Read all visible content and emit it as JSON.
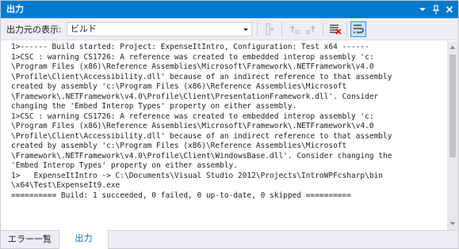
{
  "window": {
    "title": "出力",
    "controls": [
      "chevron-down-icon",
      "pin-icon",
      "close-icon"
    ]
  },
  "toolbar": {
    "source_label": "出力元の表示:",
    "source_value": "ビルド",
    "buttons": [
      {
        "name": "go-to-line-icon",
        "enabled": false
      },
      {
        "name": "find-previous-icon",
        "enabled": false
      },
      {
        "name": "find-next-icon",
        "enabled": false
      },
      {
        "name": "clear-all-icon",
        "enabled": true
      },
      {
        "name": "word-wrap-icon",
        "enabled": true,
        "toggled": true
      }
    ]
  },
  "output": {
    "lines": [
      "1>------ Build started: Project: ExpenseItIntro, Configuration: Test x64 ------",
      "1>CSC : warning CS1726: A reference was created to embedded interop assembly 'c:",
      "\\Program Files (x86)\\Reference Assemblies\\Microsoft\\Framework\\.NETFramework\\v4.0",
      "\\Profile\\Client\\Accessibility.dll' because of an indirect reference to that assembly",
      "created by assembly 'c:\\Program Files (x86)\\Reference Assemblies\\Microsoft",
      "\\Framework\\.NETFramework\\v4.0\\Profile\\Client\\PresentationFramework.dll'. Consider",
      "changing the 'Embed Interop Types' property on either assembly.",
      "1>CSC : warning CS1726: A reference was created to embedded interop assembly 'c:",
      "\\Program Files (x86)\\Reference Assemblies\\Microsoft\\Framework\\.NETFramework\\v4.0",
      "\\Profile\\Client\\Accessibility.dll' because of an indirect reference to that assembly",
      "created by assembly 'c:\\Program Files (x86)\\Reference Assemblies\\Microsoft",
      "\\Framework\\.NETFramework\\v4.0\\Profile\\Client\\WindowsBase.dll'. Consider changing the",
      "'Embed Interop Types' property on either assembly.",
      "1>   ExpenseItIntro -> C:\\Documents\\Visual Studio 2012\\Projects\\IntroWPFcsharp\\bin",
      "\\x64\\Test\\ExpenseIt9.exe",
      "========== Build: 1 succeeded, 0 failed, 0 up-to-date, 0 skipped =========="
    ]
  },
  "tabs": [
    {
      "label": "エラー一覧",
      "active": false
    },
    {
      "label": "出力",
      "active": true
    }
  ],
  "colors": {
    "title_bar": "#007acc",
    "toolbar_bg": "#eeeef2",
    "active_tab_text": "#0e70c0",
    "scroll_thumb": "#c2c3c9"
  }
}
